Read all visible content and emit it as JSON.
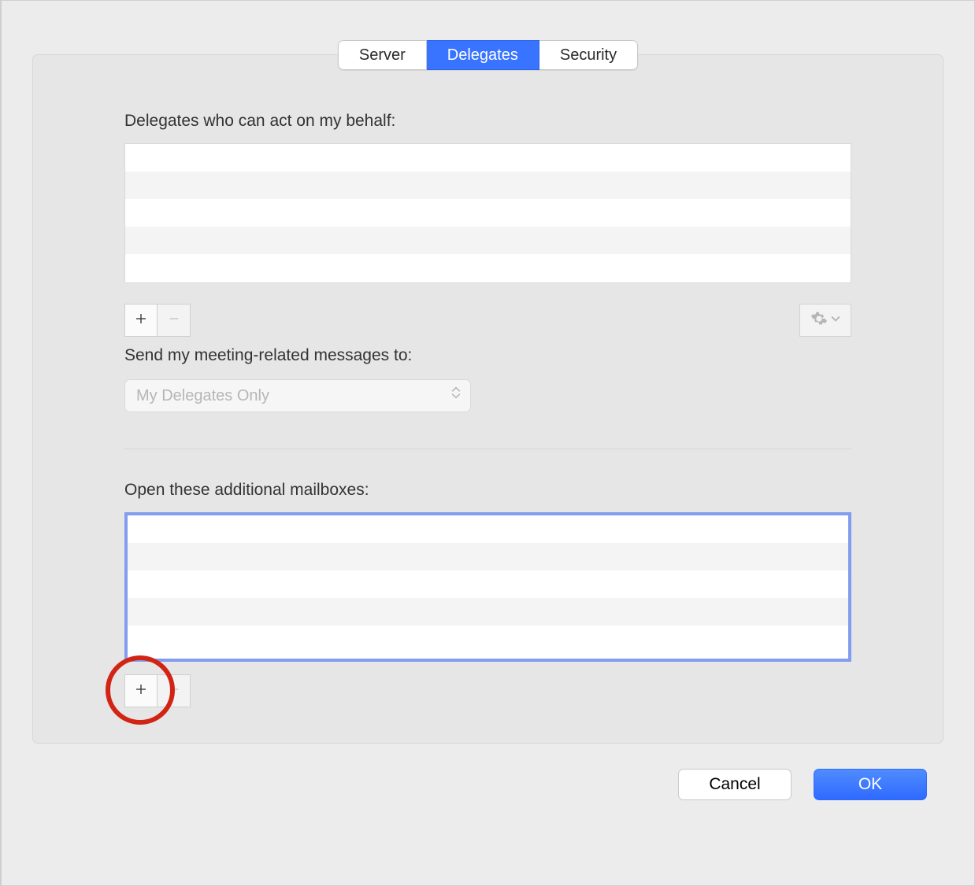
{
  "tabs": {
    "server": "Server",
    "delegates": "Delegates",
    "security": "Security",
    "active": "Delegates"
  },
  "delegates_section": {
    "label": "Delegates who can act on my behalf:",
    "send_label": "Send my meeting-related messages to:",
    "send_value": "My Delegates Only"
  },
  "mailboxes_section": {
    "label": "Open these additional mailboxes:"
  },
  "footer": {
    "cancel": "Cancel",
    "ok": "OK"
  }
}
